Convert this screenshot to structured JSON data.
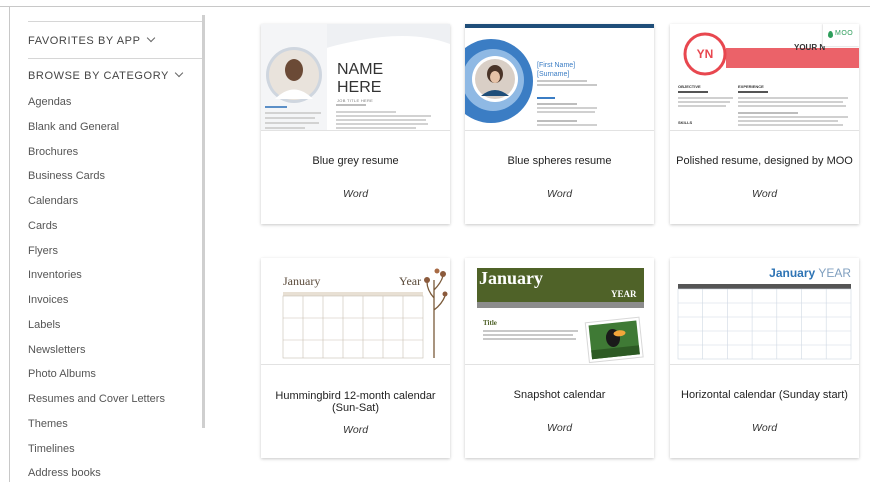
{
  "sidebar": {
    "favorites_label": "FAVORITES BY APP",
    "browse_label": "BROWSE BY CATEGORY",
    "categories": [
      "Agendas",
      "Blank and General",
      "Brochures",
      "Business Cards",
      "Calendars",
      "Cards",
      "Flyers",
      "Inventories",
      "Invoices",
      "Labels",
      "Newsletters",
      "Photo Albums",
      "Resumes and Cover Letters",
      "Themes",
      "Timelines",
      "Address books"
    ]
  },
  "templates": [
    {
      "title": "Blue grey resume",
      "app": "Word",
      "thumb": {
        "name_line1": "NAME",
        "name_line2": "HERE",
        "job_title": "JOB TITLE HERE"
      }
    },
    {
      "title": "Blue spheres resume",
      "app": "Word",
      "thumb": {
        "first_name": "[First Name]",
        "surname": "[Surname]"
      }
    },
    {
      "title": "Polished resume, designed by MOO",
      "app": "Word",
      "thumb": {
        "initials": "YN",
        "name": "YOUR N",
        "brand": "MOO",
        "sec1": "OBJECTIVE",
        "sec2": "EXPERIENCE",
        "sec3": "SKILLS"
      }
    },
    {
      "title": "Hummingbird 12-month calendar (Sun-Sat)",
      "app": "Word",
      "thumb": {
        "month": "January",
        "year": "Year"
      }
    },
    {
      "title": "Snapshot calendar",
      "app": "Word",
      "thumb": {
        "month": "January",
        "year": "YEAR",
        "subtitle": "Title"
      }
    },
    {
      "title": "Horizontal calendar (Sunday start)",
      "app": "Word",
      "thumb": {
        "month": "January",
        "year": "YEAR"
      }
    }
  ],
  "colors": {
    "accent_blue": "#2e74b5",
    "snapshot_green": "#4f6228",
    "moo_red": "#e8474f",
    "sidebar_text": "#555555"
  }
}
